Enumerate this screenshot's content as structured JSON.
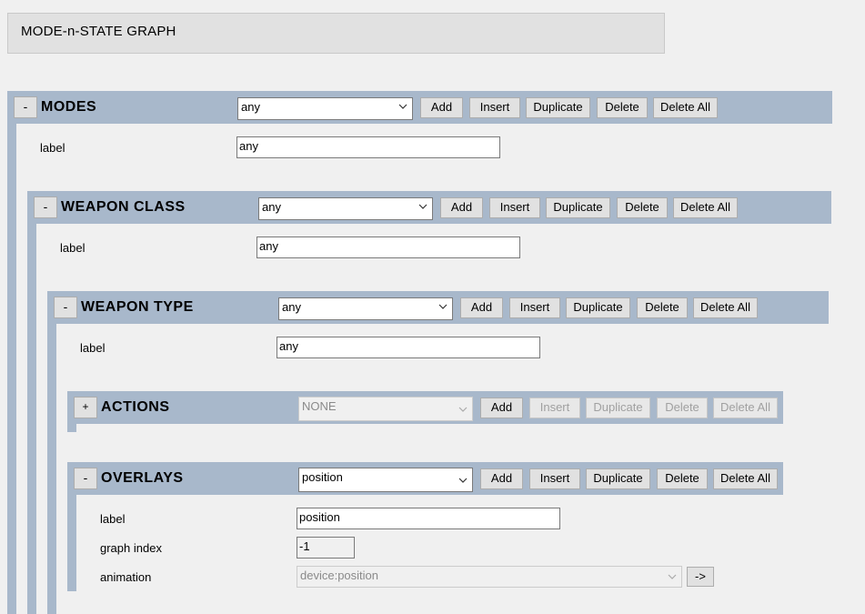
{
  "page_title": "MODE-n-STATE GRAPH",
  "buttons": {
    "add": "Add",
    "insert": "Insert",
    "duplicate": "Duplicate",
    "delete": "Delete",
    "delete_all": "Delete All",
    "goto": "->"
  },
  "sections": {
    "modes": {
      "toggle": "-",
      "title": "MODES",
      "selected": "any",
      "label_text": "label",
      "label_value": "any"
    },
    "weapon_class": {
      "toggle": "-",
      "title": "WEAPON CLASS",
      "selected": "any",
      "label_text": "label",
      "label_value": "any"
    },
    "weapon_type": {
      "toggle": "-",
      "title": "WEAPON TYPE",
      "selected": "any",
      "label_text": "label",
      "label_value": "any"
    },
    "actions": {
      "toggle": "+",
      "title": "ACTIONS",
      "selected": "NONE"
    },
    "overlays": {
      "toggle": "-",
      "title": "OVERLAYS",
      "selected": "position",
      "label_text": "label",
      "label_value": "position",
      "graph_index_text": "graph index",
      "graph_index_value": "-1",
      "animation_text": "animation",
      "animation_value": "device:position"
    }
  },
  "colors": {
    "header": "#a8b8cb",
    "background": "#f0f0f0"
  }
}
